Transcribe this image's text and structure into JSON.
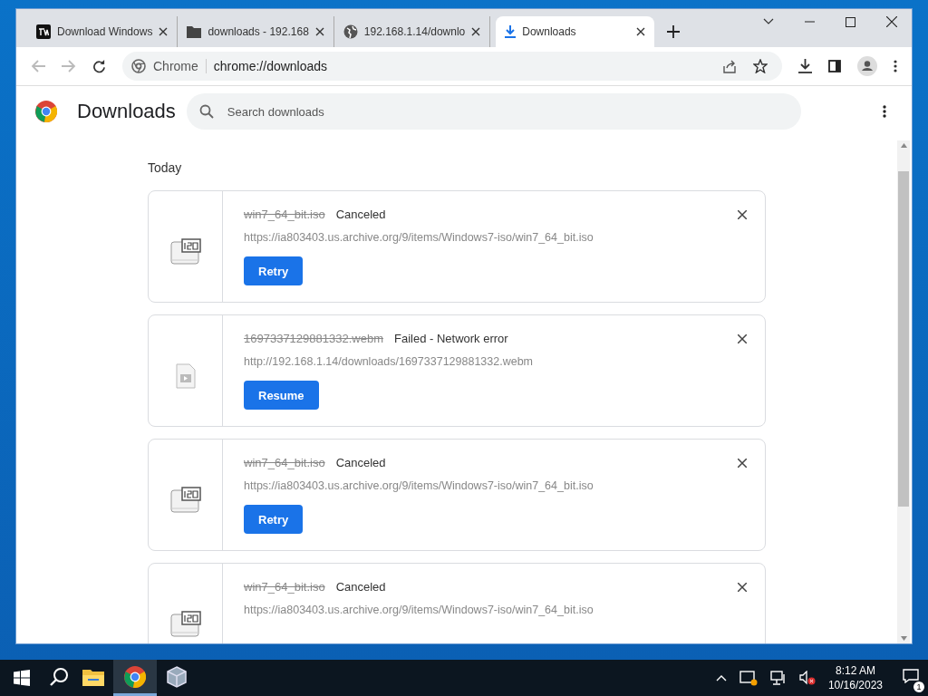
{
  "tabs": [
    {
      "title": "Download Windows",
      "kind": "logo",
      "selected": false
    },
    {
      "title": "downloads - 192.168",
      "kind": "folder",
      "selected": false
    },
    {
      "title": "192.168.1.14/downlo",
      "kind": "globe",
      "selected": false
    },
    {
      "title": "Downloads",
      "kind": "download",
      "selected": true
    }
  ],
  "address_bar": {
    "site": "Chrome",
    "url": "chrome://downloads"
  },
  "page": {
    "title": "Downloads",
    "search": {
      "placeholder": "Search downloads"
    },
    "section": "Today",
    "items": [
      {
        "file": "win7_64_bit.iso",
        "kind": "iso",
        "status": "Canceled",
        "url": "https://ia803403.us.archive.org/9/items/Windows7-iso/win7_64_bit.iso",
        "action": "Retry"
      },
      {
        "file": "1697337129881332.webm",
        "kind": "video",
        "status": "Failed - Network error",
        "url": "http://192.168.1.14/downloads/1697337129881332.webm",
        "action": "Resume"
      },
      {
        "file": "win7_64_bit.iso",
        "kind": "iso",
        "status": "Canceled",
        "url": "https://ia803403.us.archive.org/9/items/Windows7-iso/win7_64_bit.iso",
        "action": "Retry"
      },
      {
        "file": "win7_64_bit.iso",
        "kind": "iso",
        "status": "Canceled",
        "url": "https://ia803403.us.archive.org/9/items/Windows7-iso/win7_64_bit.iso"
      }
    ]
  },
  "taskbar": {
    "apps": [
      {
        "kind": "search",
        "selected": false
      },
      {
        "kind": "explorer",
        "selected": false
      },
      {
        "kind": "chrome",
        "selected": true
      },
      {
        "kind": "box",
        "selected": false
      }
    ],
    "time": "8:12 AM",
    "date": "10/16/2023",
    "notifications": "1"
  }
}
